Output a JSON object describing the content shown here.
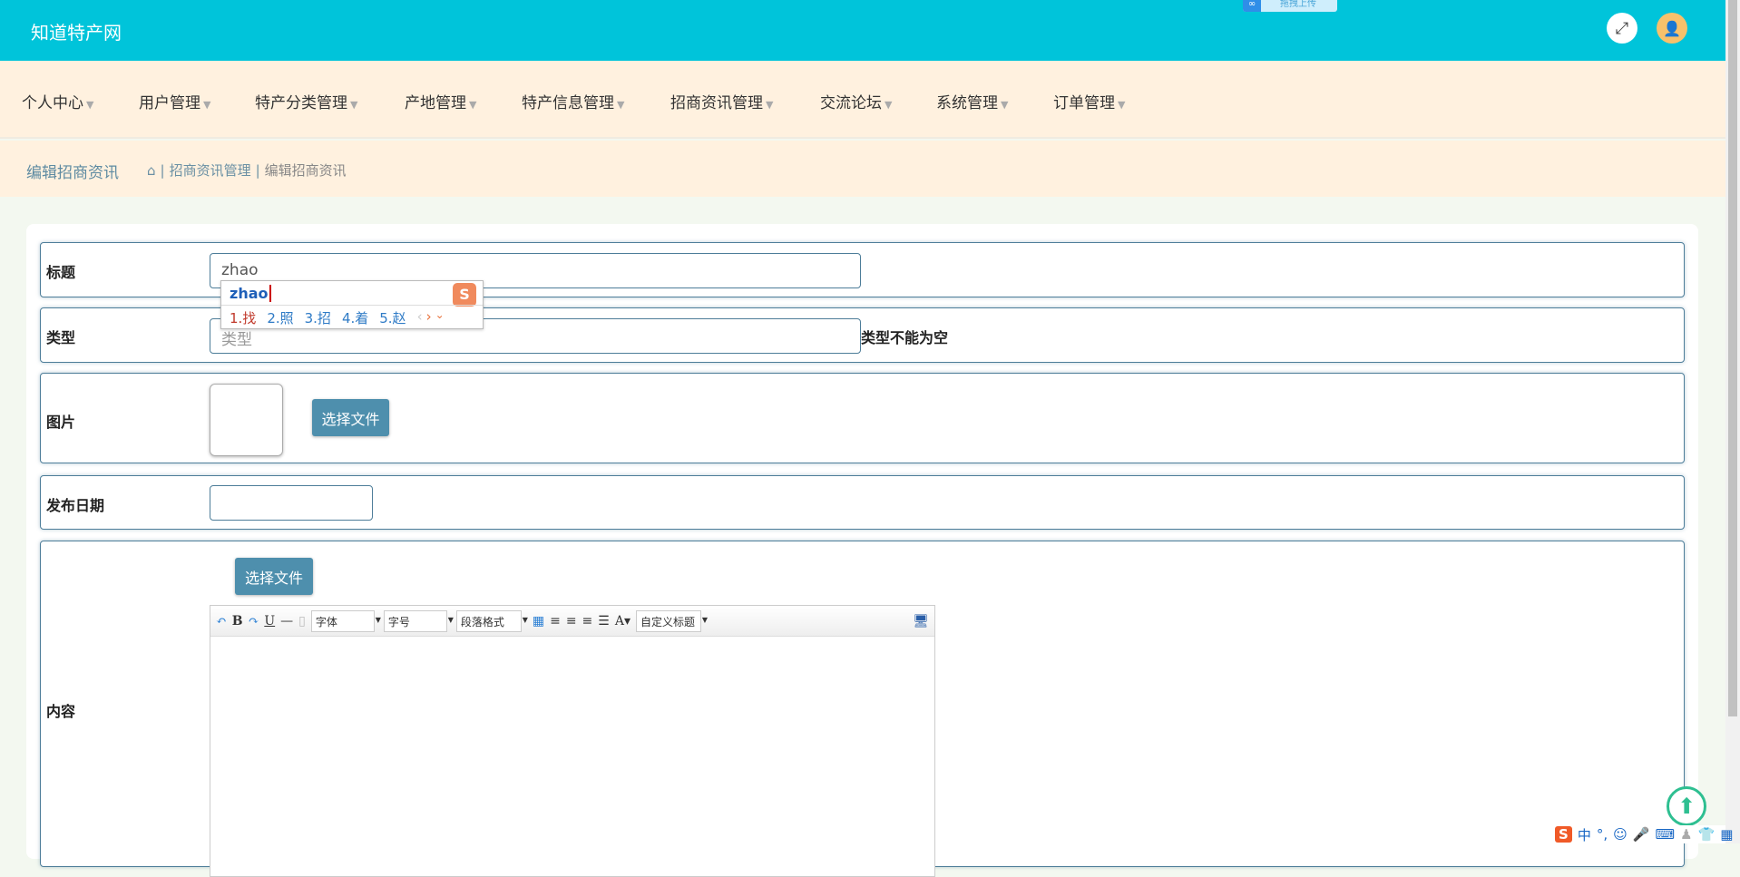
{
  "header": {
    "title": "知道特产网",
    "upload_badge": "拖拽上传"
  },
  "nav": {
    "items": [
      "个人中心",
      "用户管理",
      "特产分类管理",
      "产地管理",
      "特产信息管理",
      "招商资讯管理",
      "交流论坛",
      "系统管理",
      "订单管理"
    ]
  },
  "breadcrumb": {
    "title": "编辑招商资讯",
    "items": [
      "招商资讯管理",
      "编辑招商资讯"
    ]
  },
  "form": {
    "title_label": "标题",
    "title_value": "zhao",
    "type_label": "类型",
    "type_placeholder": "类型",
    "type_error": "类型不能为空",
    "image_label": "图片",
    "image_button": "选择文件",
    "date_label": "发布日期",
    "date_value": "",
    "content_label": "内容",
    "content_button": "选择文件"
  },
  "editor": {
    "font": "字体",
    "size": "字号",
    "paragraph": "段落格式",
    "custom_title": "自定义标题"
  },
  "ime": {
    "composition": "zhao",
    "candidates": [
      "1.找",
      "2.照",
      "3.招",
      "4.着",
      "5.赵"
    ],
    "status": "中"
  },
  "colors": {
    "header": "#00c4da",
    "nav": "#fff1df",
    "accent": "#4e8fad"
  }
}
